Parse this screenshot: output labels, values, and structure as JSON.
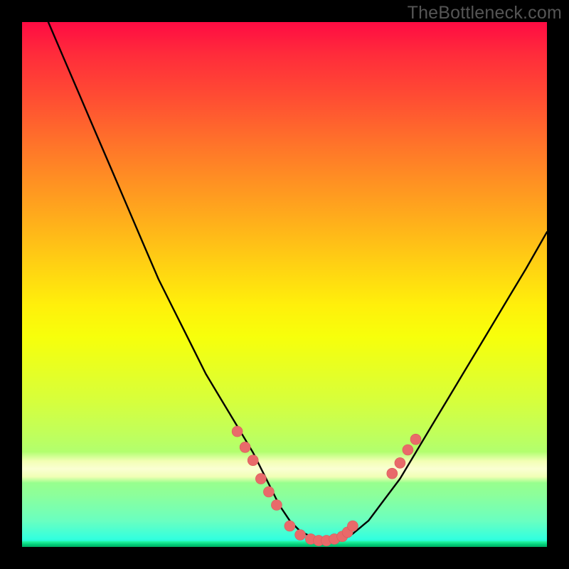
{
  "watermark": "TheBottleneck.com",
  "colors": {
    "curve_stroke": "#000000",
    "marker_fill": "#e96a6a",
    "marker_stroke": "#d85a5a"
  },
  "chart_data": {
    "type": "line",
    "title": "",
    "xlabel": "",
    "ylabel": "",
    "xlim": [
      0,
      100
    ],
    "ylim": [
      0,
      100
    ],
    "note": "No axis labels or ticks are visible in the image; values are inferred from pixel positions normalized to a 0–100 range where y=0 is bottom (optimum) and y=100 is top.",
    "series": [
      {
        "name": "bottleneck-curve",
        "x": [
          5,
          8,
          11,
          14,
          17,
          20,
          23,
          26,
          29,
          32,
          35,
          38,
          41,
          44,
          47,
          49,
          51,
          53,
          55,
          57,
          59,
          61,
          63,
          66,
          69,
          72,
          75,
          78,
          81,
          84,
          87,
          90,
          93,
          96,
          100
        ],
        "y": [
          100,
          93,
          86,
          79,
          72,
          65,
          58,
          51,
          45,
          39,
          33,
          28,
          23,
          18,
          12,
          8,
          5,
          3,
          2,
          1.3,
          1,
          1.3,
          2.5,
          5,
          9,
          13,
          18,
          23,
          28,
          33,
          38,
          43,
          48,
          53,
          60
        ]
      }
    ],
    "markers": {
      "name": "highlighted-points",
      "note": "Salmon dots clustered near the valley and on the rising right limb",
      "points": [
        {
          "x": 41,
          "y": 22
        },
        {
          "x": 42.5,
          "y": 19
        },
        {
          "x": 44,
          "y": 16.5
        },
        {
          "x": 45.5,
          "y": 13
        },
        {
          "x": 47,
          "y": 10.5
        },
        {
          "x": 48.5,
          "y": 8
        },
        {
          "x": 51,
          "y": 4
        },
        {
          "x": 53,
          "y": 2.3
        },
        {
          "x": 55,
          "y": 1.5
        },
        {
          "x": 56.5,
          "y": 1.2
        },
        {
          "x": 58,
          "y": 1.2
        },
        {
          "x": 59.5,
          "y": 1.5
        },
        {
          "x": 61,
          "y": 2
        },
        {
          "x": 62,
          "y": 2.8
        },
        {
          "x": 63,
          "y": 4
        },
        {
          "x": 70.5,
          "y": 14
        },
        {
          "x": 72,
          "y": 16
        },
        {
          "x": 73.5,
          "y": 18.5
        },
        {
          "x": 75,
          "y": 20.5
        }
      ]
    }
  }
}
